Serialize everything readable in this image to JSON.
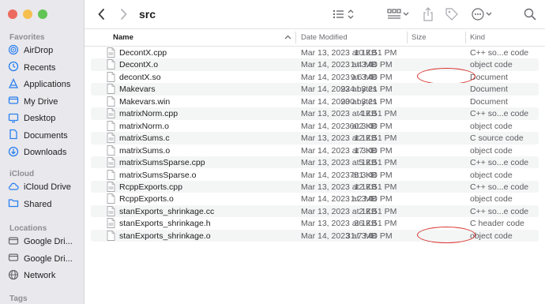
{
  "window": {
    "title": "src"
  },
  "sidebar": {
    "sections": [
      {
        "title": "Favorites",
        "items": [
          {
            "label": "AirDrop",
            "icon": "airdrop-icon"
          },
          {
            "label": "Recents",
            "icon": "clock-icon"
          },
          {
            "label": "Applications",
            "icon": "applications-icon"
          },
          {
            "label": "My Drive",
            "icon": "drive-icon"
          },
          {
            "label": "Desktop",
            "icon": "desktop-icon"
          },
          {
            "label": "Documents",
            "icon": "document-icon"
          },
          {
            "label": "Downloads",
            "icon": "download-icon"
          }
        ]
      },
      {
        "title": "iCloud",
        "items": [
          {
            "label": "iCloud Drive",
            "icon": "cloud-icon"
          },
          {
            "label": "Shared",
            "icon": "shared-folder-icon"
          }
        ]
      },
      {
        "title": "Locations",
        "items": [
          {
            "label": "Google Dri...",
            "icon": "drive-icon"
          },
          {
            "label": "Google Dri...",
            "icon": "drive-icon"
          },
          {
            "label": "Network",
            "icon": "network-icon"
          }
        ]
      },
      {
        "title": "Tags",
        "items": []
      }
    ]
  },
  "columns": {
    "name": "Name",
    "date": "Date Modified",
    "size": "Size",
    "kind": "Kind"
  },
  "files": [
    {
      "name": "DecontX.cpp",
      "date": "Mar 13, 2023 at 12:51 PM",
      "size": "10 KB",
      "kind": "C++ so...e code",
      "icon": "cpp-file-icon"
    },
    {
      "name": "DecontX.o",
      "date": "Mar 14, 2023 at 3:40 PM",
      "size": "1.4 MB",
      "kind": "object code",
      "icon": "file-icon"
    },
    {
      "name": "decontX.so",
      "date": "Mar 14, 2023 at 3:40 PM",
      "size": "9.6 MB",
      "kind": "Document",
      "icon": "file-icon",
      "highlighted": true
    },
    {
      "name": "Makevars",
      "date": "Mar 14, 2023 at 3:21 PM",
      "size": "924 bytes",
      "kind": "Document",
      "icon": "file-icon"
    },
    {
      "name": "Makevars.win",
      "date": "Mar 14, 2023 at 3:21 PM",
      "size": "900 bytes",
      "kind": "Document",
      "icon": "file-icon"
    },
    {
      "name": "matrixNorm.cpp",
      "date": "Mar 13, 2023 at 12:51 PM",
      "size": "4 KB",
      "kind": "C++ so...e code",
      "icon": "cpp-file-icon"
    },
    {
      "name": "matrixNorm.o",
      "date": "Mar 14, 2023 at 3:40 PM",
      "size": "602 KB",
      "kind": "object code",
      "icon": "file-icon"
    },
    {
      "name": "matrixSums.c",
      "date": "Mar 13, 2023 at 12:51 PM",
      "size": "12 KB",
      "kind": "C source code",
      "icon": "c-file-icon"
    },
    {
      "name": "matrixSums.o",
      "date": "Mar 14, 2023 at 3:40 PM",
      "size": "17 KB",
      "kind": "object code",
      "icon": "file-icon"
    },
    {
      "name": "matrixSumsSparse.cpp",
      "date": "Mar 13, 2023 at 12:51 PM",
      "size": "5 KB",
      "kind": "C++ so...e code",
      "icon": "cpp-file-icon"
    },
    {
      "name": "matrixSumsSparse.o",
      "date": "Mar 14, 2023 at 3:40 PM",
      "size": "751 KB",
      "kind": "object code",
      "icon": "file-icon"
    },
    {
      "name": "RcppExports.cpp",
      "date": "Mar 13, 2023 at 12:51 PM",
      "size": "12 KB",
      "kind": "C++ so...e code",
      "icon": "cpp-file-icon"
    },
    {
      "name": "RcppExports.o",
      "date": "Mar 14, 2023 at 3:40 PM",
      "size": "1.2 MB",
      "kind": "object code",
      "icon": "file-icon"
    },
    {
      "name": "stanExports_shrinkage.cc",
      "date": "Mar 13, 2023 at 12:51 PM",
      "size": "2 KB",
      "kind": "C++ so...e code",
      "icon": "cc-file-icon"
    },
    {
      "name": "stanExports_shrinkage.h",
      "date": "Mar 13, 2023 at 12:51 PM",
      "size": "36 KB",
      "kind": "C header code",
      "icon": "h-file-icon"
    },
    {
      "name": "stanExports_shrinkage.o",
      "date": "Mar 14, 2023 at 3:40 PM",
      "size": "31.7 MB",
      "kind": "object code",
      "icon": "file-icon",
      "highlighted": true
    }
  ],
  "colors": {
    "highlight_ring": "#d6302b",
    "sidebar_bg": "#e9e8ec",
    "alt_row": "#f4f5f5"
  }
}
